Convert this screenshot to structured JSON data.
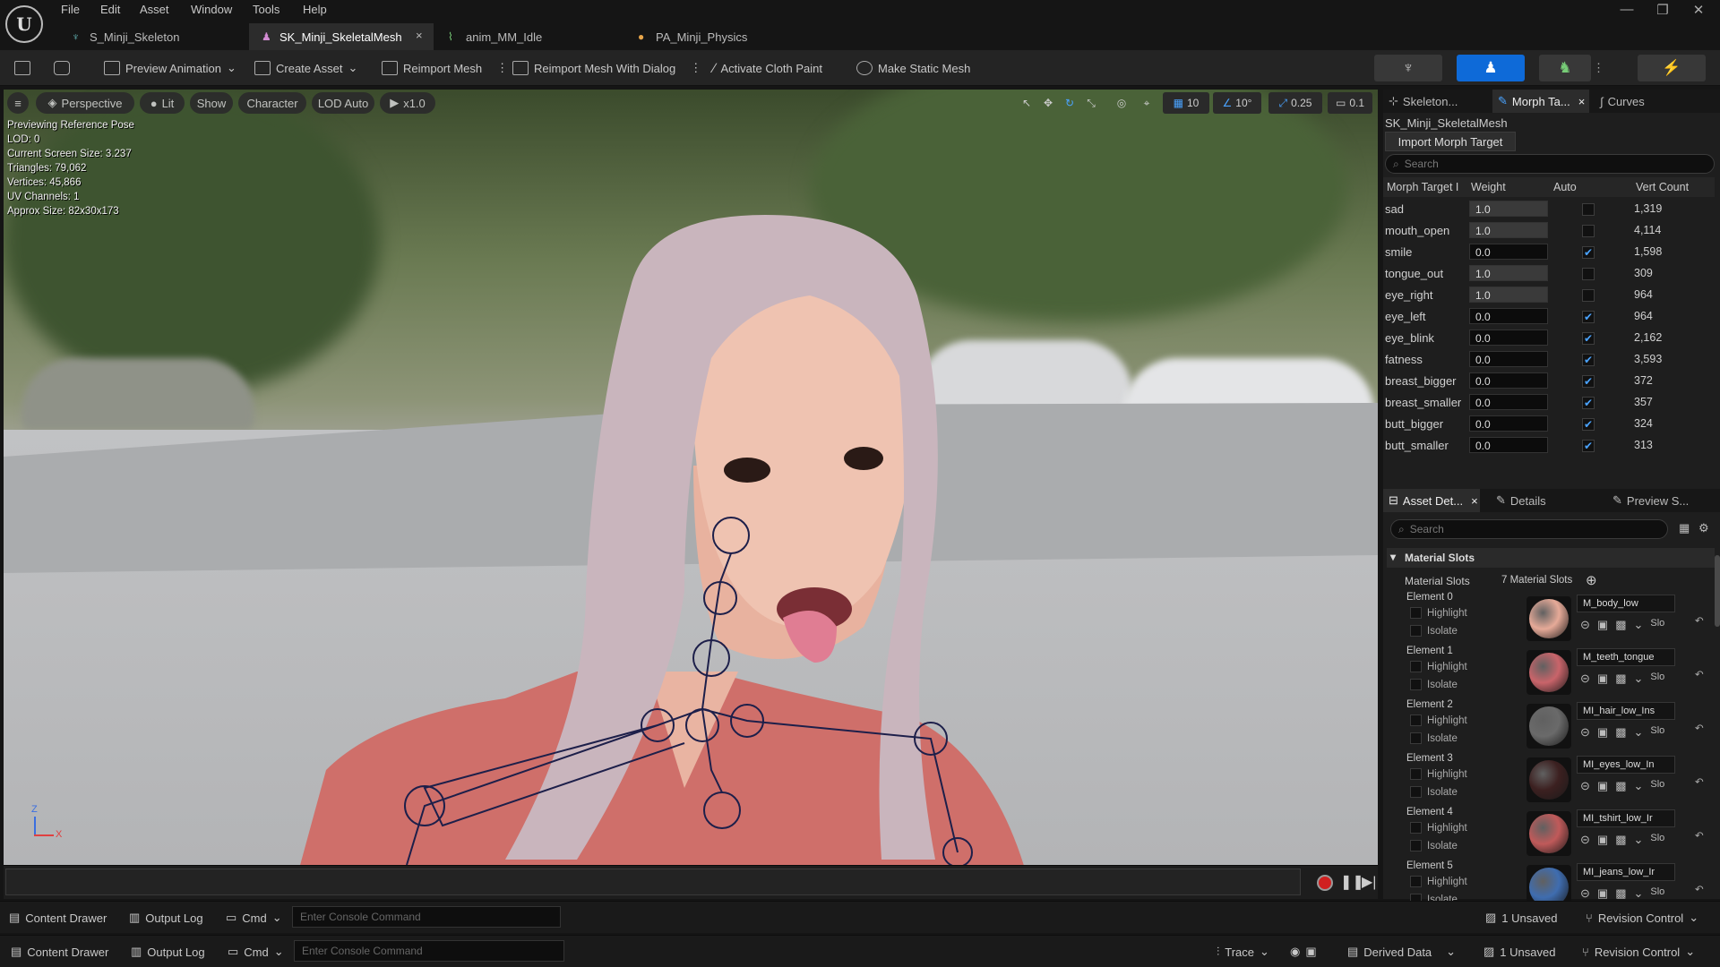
{
  "menu": [
    "File",
    "Edit",
    "Asset",
    "Window",
    "Tools",
    "Help"
  ],
  "doc_tabs": [
    {
      "label": "S_Minji_Skeleton",
      "active": false
    },
    {
      "label": "SK_Minji_SkeletalMesh",
      "active": true,
      "close": "×"
    },
    {
      "label": "anim_MM_Idle",
      "active": false
    },
    {
      "label": "PA_Minji_Physics",
      "active": false
    }
  ],
  "window_controls": {
    "minimize": "—",
    "restore": "❐",
    "close": "✕"
  },
  "toolbar": {
    "preview_animation": "Preview Animation",
    "create_asset": "Create Asset",
    "reimport_mesh": "Reimport Mesh",
    "reimport_mesh_dialog": "Reimport Mesh With Dialog",
    "activate_cloth_paint": "Activate Cloth Paint",
    "make_static_mesh": "Make Static Mesh"
  },
  "viewport": {
    "perspective": "Perspective",
    "lit": "Lit",
    "show": "Show",
    "character": "Character",
    "lod": "LOD Auto",
    "speed": "x1.0",
    "grid_snap": "10",
    "rot_snap": "10°",
    "scale_snap": "0.25",
    "cam_speed": "0.1",
    "stats": [
      "Previewing Reference Pose",
      "LOD: 0",
      "Current Screen Size: 3.237",
      "Triangles: 79,062",
      "Vertices: 45,866",
      "UV Channels: 1",
      "Approx Size: 82x30x173"
    ],
    "axis_z": "Z",
    "axis_x": "X"
  },
  "right_tabs": [
    {
      "label": "Skeleton...",
      "active": false
    },
    {
      "label": "Morph Ta...",
      "active": true,
      "close": "×"
    },
    {
      "label": "Curves",
      "active": false
    }
  ],
  "morph": {
    "asset_name": "SK_Minji_SkeletalMesh",
    "import_button": "Import Morph Target",
    "search_placeholder": "Search",
    "headers": [
      "Morph Target I",
      "Weight",
      "Auto",
      "Vert Count"
    ],
    "rows": [
      {
        "name": "sad",
        "weight": "1.0",
        "auto": false,
        "verts": "1,319"
      },
      {
        "name": "mouth_open",
        "weight": "1.0",
        "auto": false,
        "verts": "4,114"
      },
      {
        "name": "smile",
        "weight": "0.0",
        "auto": true,
        "verts": "1,598"
      },
      {
        "name": "tongue_out",
        "weight": "1.0",
        "auto": false,
        "verts": "309"
      },
      {
        "name": "eye_right",
        "weight": "1.0",
        "auto": false,
        "verts": "964"
      },
      {
        "name": "eye_left",
        "weight": "0.0",
        "auto": true,
        "verts": "964"
      },
      {
        "name": "eye_blink",
        "weight": "0.0",
        "auto": true,
        "verts": "2,162"
      },
      {
        "name": "fatness",
        "weight": "0.0",
        "auto": true,
        "verts": "3,593"
      },
      {
        "name": "breast_bigger",
        "weight": "0.0",
        "auto": true,
        "verts": "372"
      },
      {
        "name": "breast_smaller",
        "weight": "0.0",
        "auto": true,
        "verts": "357"
      },
      {
        "name": "butt_bigger",
        "weight": "0.0",
        "auto": true,
        "verts": "324"
      },
      {
        "name": "butt_smaller",
        "weight": "0.0",
        "auto": true,
        "verts": "313"
      }
    ]
  },
  "details_tabs": [
    {
      "label": "Asset Det...",
      "active": true,
      "close": "×"
    },
    {
      "label": "Details",
      "active": false
    },
    {
      "label": "Preview S...",
      "active": false
    }
  ],
  "details": {
    "search_placeholder": "Search",
    "section": "Material Slots",
    "slots_label": "Material Slots",
    "slots_count": "7 Material Slots",
    "highlight": "Highlight",
    "isolate": "Isolate",
    "slot_suffix": "Slo",
    "elements": [
      {
        "label": "Element 0",
        "material": "M_body_low",
        "color": "#e6aa98"
      },
      {
        "label": "Element 1",
        "material": "M_teeth_tongue",
        "color": "#c9646a"
      },
      {
        "label": "Element 2",
        "material": "MI_hair_low_Ins",
        "color": "#6a6a6a"
      },
      {
        "label": "Element 3",
        "material": "MI_eyes_low_In",
        "color": "#3c2020"
      },
      {
        "label": "Element 4",
        "material": "MI_tshirt_low_Ir",
        "color": "#c05a5a"
      },
      {
        "label": "Element 5",
        "material": "MI_jeans_low_Ir",
        "color": "#3f6db0"
      }
    ]
  },
  "bottom": {
    "content_drawer": "Content Drawer",
    "output_log": "Output Log",
    "cmd": "Cmd",
    "console_placeholder": "Enter Console Command",
    "unsaved": "1 Unsaved",
    "revision_control": "Revision Control",
    "trace": "Trace",
    "derived_data": "Derived Data"
  }
}
